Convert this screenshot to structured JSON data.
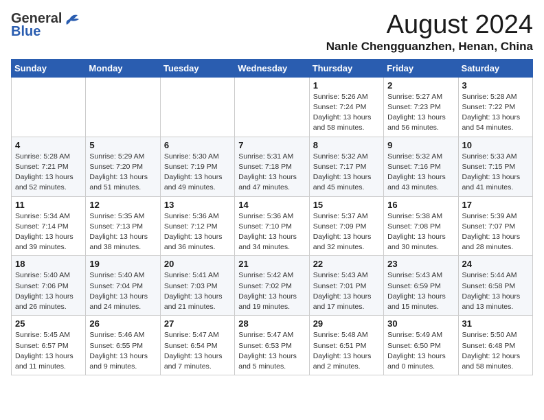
{
  "header": {
    "logo_general": "General",
    "logo_blue": "Blue",
    "month_title": "August 2024",
    "location": "Nanle Chengguanzhen, Henan, China"
  },
  "weekdays": [
    "Sunday",
    "Monday",
    "Tuesday",
    "Wednesday",
    "Thursday",
    "Friday",
    "Saturday"
  ],
  "weeks": [
    [
      {
        "day": "",
        "info": ""
      },
      {
        "day": "",
        "info": ""
      },
      {
        "day": "",
        "info": ""
      },
      {
        "day": "",
        "info": ""
      },
      {
        "day": "1",
        "info": "Sunrise: 5:26 AM\nSunset: 7:24 PM\nDaylight: 13 hours\nand 58 minutes."
      },
      {
        "day": "2",
        "info": "Sunrise: 5:27 AM\nSunset: 7:23 PM\nDaylight: 13 hours\nand 56 minutes."
      },
      {
        "day": "3",
        "info": "Sunrise: 5:28 AM\nSunset: 7:22 PM\nDaylight: 13 hours\nand 54 minutes."
      }
    ],
    [
      {
        "day": "4",
        "info": "Sunrise: 5:28 AM\nSunset: 7:21 PM\nDaylight: 13 hours\nand 52 minutes."
      },
      {
        "day": "5",
        "info": "Sunrise: 5:29 AM\nSunset: 7:20 PM\nDaylight: 13 hours\nand 51 minutes."
      },
      {
        "day": "6",
        "info": "Sunrise: 5:30 AM\nSunset: 7:19 PM\nDaylight: 13 hours\nand 49 minutes."
      },
      {
        "day": "7",
        "info": "Sunrise: 5:31 AM\nSunset: 7:18 PM\nDaylight: 13 hours\nand 47 minutes."
      },
      {
        "day": "8",
        "info": "Sunrise: 5:32 AM\nSunset: 7:17 PM\nDaylight: 13 hours\nand 45 minutes."
      },
      {
        "day": "9",
        "info": "Sunrise: 5:32 AM\nSunset: 7:16 PM\nDaylight: 13 hours\nand 43 minutes."
      },
      {
        "day": "10",
        "info": "Sunrise: 5:33 AM\nSunset: 7:15 PM\nDaylight: 13 hours\nand 41 minutes."
      }
    ],
    [
      {
        "day": "11",
        "info": "Sunrise: 5:34 AM\nSunset: 7:14 PM\nDaylight: 13 hours\nand 39 minutes."
      },
      {
        "day": "12",
        "info": "Sunrise: 5:35 AM\nSunset: 7:13 PM\nDaylight: 13 hours\nand 38 minutes."
      },
      {
        "day": "13",
        "info": "Sunrise: 5:36 AM\nSunset: 7:12 PM\nDaylight: 13 hours\nand 36 minutes."
      },
      {
        "day": "14",
        "info": "Sunrise: 5:36 AM\nSunset: 7:10 PM\nDaylight: 13 hours\nand 34 minutes."
      },
      {
        "day": "15",
        "info": "Sunrise: 5:37 AM\nSunset: 7:09 PM\nDaylight: 13 hours\nand 32 minutes."
      },
      {
        "day": "16",
        "info": "Sunrise: 5:38 AM\nSunset: 7:08 PM\nDaylight: 13 hours\nand 30 minutes."
      },
      {
        "day": "17",
        "info": "Sunrise: 5:39 AM\nSunset: 7:07 PM\nDaylight: 13 hours\nand 28 minutes."
      }
    ],
    [
      {
        "day": "18",
        "info": "Sunrise: 5:40 AM\nSunset: 7:06 PM\nDaylight: 13 hours\nand 26 minutes."
      },
      {
        "day": "19",
        "info": "Sunrise: 5:40 AM\nSunset: 7:04 PM\nDaylight: 13 hours\nand 24 minutes."
      },
      {
        "day": "20",
        "info": "Sunrise: 5:41 AM\nSunset: 7:03 PM\nDaylight: 13 hours\nand 21 minutes."
      },
      {
        "day": "21",
        "info": "Sunrise: 5:42 AM\nSunset: 7:02 PM\nDaylight: 13 hours\nand 19 minutes."
      },
      {
        "day": "22",
        "info": "Sunrise: 5:43 AM\nSunset: 7:01 PM\nDaylight: 13 hours\nand 17 minutes."
      },
      {
        "day": "23",
        "info": "Sunrise: 5:43 AM\nSunset: 6:59 PM\nDaylight: 13 hours\nand 15 minutes."
      },
      {
        "day": "24",
        "info": "Sunrise: 5:44 AM\nSunset: 6:58 PM\nDaylight: 13 hours\nand 13 minutes."
      }
    ],
    [
      {
        "day": "25",
        "info": "Sunrise: 5:45 AM\nSunset: 6:57 PM\nDaylight: 13 hours\nand 11 minutes."
      },
      {
        "day": "26",
        "info": "Sunrise: 5:46 AM\nSunset: 6:55 PM\nDaylight: 13 hours\nand 9 minutes."
      },
      {
        "day": "27",
        "info": "Sunrise: 5:47 AM\nSunset: 6:54 PM\nDaylight: 13 hours\nand 7 minutes."
      },
      {
        "day": "28",
        "info": "Sunrise: 5:47 AM\nSunset: 6:53 PM\nDaylight: 13 hours\nand 5 minutes."
      },
      {
        "day": "29",
        "info": "Sunrise: 5:48 AM\nSunset: 6:51 PM\nDaylight: 13 hours\nand 2 minutes."
      },
      {
        "day": "30",
        "info": "Sunrise: 5:49 AM\nSunset: 6:50 PM\nDaylight: 13 hours\nand 0 minutes."
      },
      {
        "day": "31",
        "info": "Sunrise: 5:50 AM\nSunset: 6:48 PM\nDaylight: 12 hours\nand 58 minutes."
      }
    ]
  ]
}
